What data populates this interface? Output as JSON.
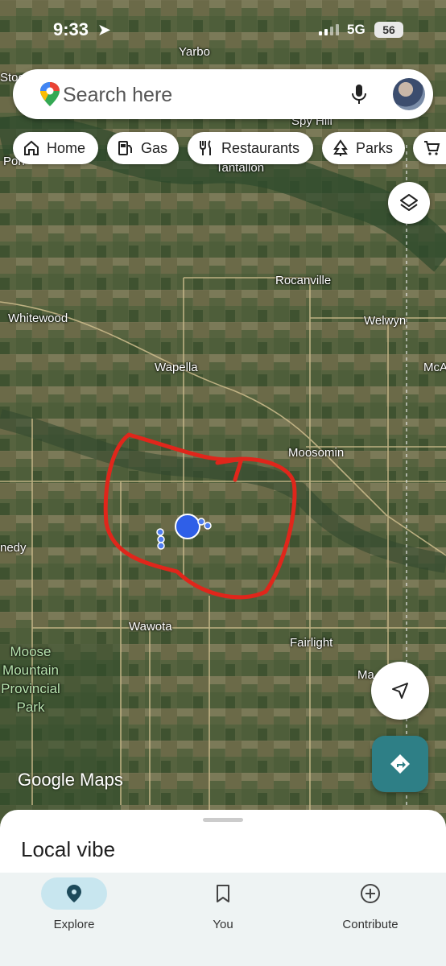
{
  "status": {
    "time": "9:33",
    "network": "5G",
    "battery": "56"
  },
  "search": {
    "placeholder": "Search here"
  },
  "chips": [
    {
      "label": "Home",
      "icon": "home-icon"
    },
    {
      "label": "Gas",
      "icon": "gas-station-icon"
    },
    {
      "label": "Restaurants",
      "icon": "restaurant-icon"
    },
    {
      "label": "Parks",
      "icon": "tree-icon"
    },
    {
      "label": "",
      "icon": "shopping-cart-icon"
    }
  ],
  "map": {
    "labels": {
      "yarbo": "Yarbo",
      "stock": "Stoc",
      "spy_hill": "Spy Hill",
      "pons": "Pon",
      "tantallon": "Tantallon",
      "rocanville": "Rocanville",
      "whitewood": "Whitewood",
      "welwyn": "Welwyn",
      "mca": "McA",
      "wapella": "Wapella",
      "moosomin": "Moosomin",
      "kennedy": "nedy",
      "wawota": "Wawota",
      "fairlight": "Fairlight",
      "ma": "Ma",
      "park_line1": "Moose",
      "park_line2": "Mountain",
      "park_line3": "Provincial",
      "park_line4": "Park"
    },
    "watermark": "Google Maps"
  },
  "sheet": {
    "title": "Local vibe"
  },
  "nav": {
    "explore": "Explore",
    "you": "You",
    "contribute": "Contribute"
  },
  "colors": {
    "accent": "#2e7f86",
    "location_dot": "#2f5fe8",
    "annotation": "#e0261b",
    "nav_pill": "#c8e6ef"
  }
}
